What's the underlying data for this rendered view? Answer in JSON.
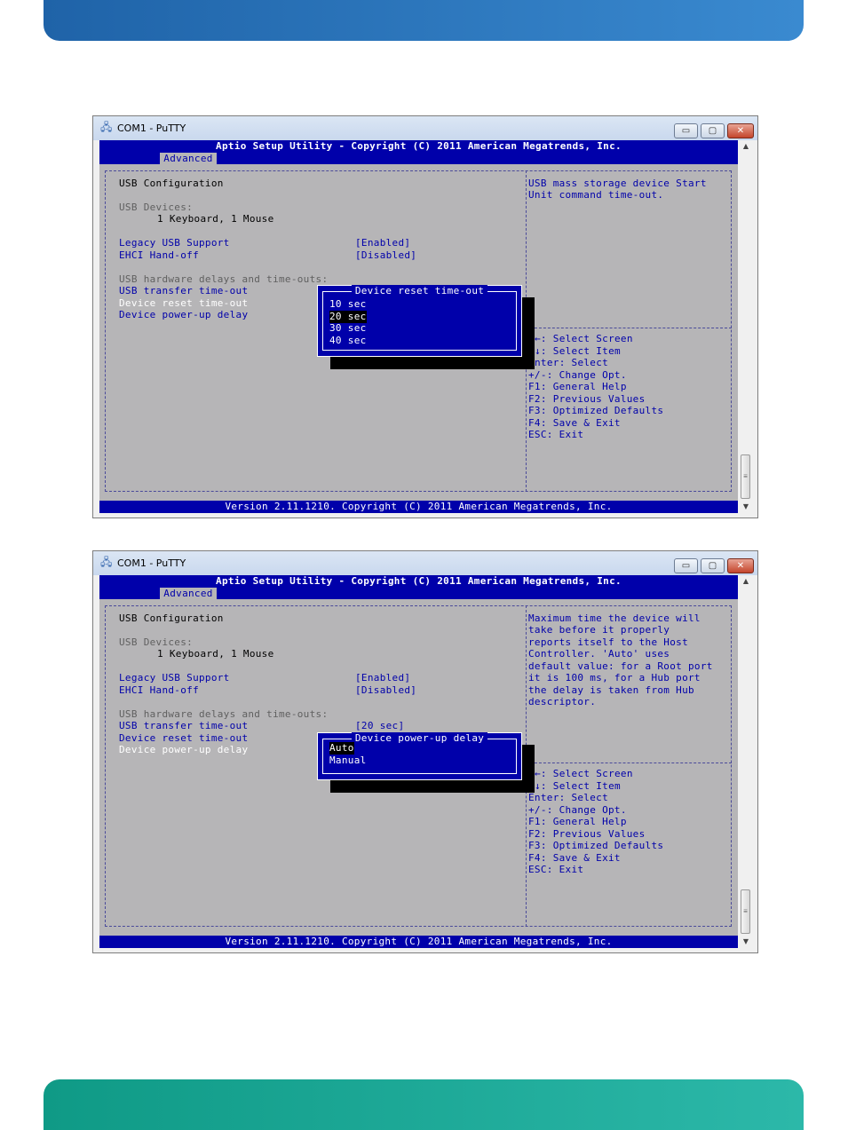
{
  "windows": [
    {
      "title": "COM1 - PuTTY",
      "window_buttons": {
        "minimize": "▭",
        "maximize": "▢",
        "close": "✕"
      },
      "header": "Aptio Setup Utility - Copyright (C) 2011 American Megatrends, Inc.",
      "tab": "Advanced",
      "footer": "Version 2.11.1210. Copyright (C) 2011 American Megatrends, Inc.",
      "section_title": "USB Configuration",
      "usb_devices_label": "USB Devices:",
      "usb_devices_value": "1 Keyboard, 1 Mouse",
      "legacy_label": "Legacy USB Support",
      "legacy_value": "[Enabled]",
      "ehci_label": "EHCI Hand-off",
      "ehci_value": "[Disabled]",
      "delays_label": "USB hardware delays and time-outs:",
      "transfer_label": "USB transfer time-out",
      "transfer_value": "",
      "reset_label": "Device reset time-out",
      "powerup_label": "Device power-up delay",
      "help_lines": [
        "USB mass storage device Start",
        "Unit command time-out."
      ],
      "keys": [
        "←: Select Screen",
        "↓: Select Item",
        "nter: Select",
        "+/-: Change Opt.",
        "F1: General Help",
        "F2: Previous Values",
        "F3: Optimized Defaults",
        "F4: Save & Exit",
        "ESC: Exit"
      ],
      "popup": {
        "title": "Device reset time-out",
        "options": [
          "10 sec",
          "20 sec",
          "30 sec",
          "40 sec"
        ],
        "selected": "20 sec"
      }
    },
    {
      "title": "COM1 - PuTTY",
      "window_buttons": {
        "minimize": "▭",
        "maximize": "▢",
        "close": "✕"
      },
      "header": "Aptio Setup Utility - Copyright (C) 2011 American Megatrends, Inc.",
      "tab": "Advanced",
      "footer": "Version 2.11.1210. Copyright (C) 2011 American Megatrends, Inc.",
      "section_title": "USB Configuration",
      "usb_devices_label": "USB Devices:",
      "usb_devices_value": "1 Keyboard, 1 Mouse",
      "legacy_label": "Legacy USB Support",
      "legacy_value": "[Enabled]",
      "ehci_label": "EHCI Hand-off",
      "ehci_value": "[Disabled]",
      "delays_label": "USB hardware delays and time-outs:",
      "transfer_label": "USB transfer time-out",
      "transfer_value": "[20 sec]",
      "reset_label": "Device reset time-out",
      "powerup_label": "Device power-up delay",
      "help_lines": [
        "Maximum time the device will",
        "take before it properly",
        "reports itself to the Host",
        "Controller. 'Auto' uses",
        "default value: for a Root port",
        "it is 100 ms, for a Hub port",
        "the delay is taken from Hub",
        "descriptor."
      ],
      "keys": [
        "←: Select Screen",
        "↓: Select Item",
        "Enter: Select",
        "+/-: Change Opt.",
        "F1: General Help",
        "F2: Previous Values",
        "F3: Optimized Defaults",
        "F4: Save & Exit",
        "ESC: Exit"
      ],
      "popup": {
        "title": "Device power-up delay",
        "options": [
          "Auto",
          "Manual"
        ],
        "selected": "Auto"
      }
    }
  ],
  "colors": {
    "bios_blue": "#0000aa",
    "bios_grey": "#b6b5b7",
    "top_bar": "#2a78c0",
    "bottom_bar": "#1aa999"
  }
}
